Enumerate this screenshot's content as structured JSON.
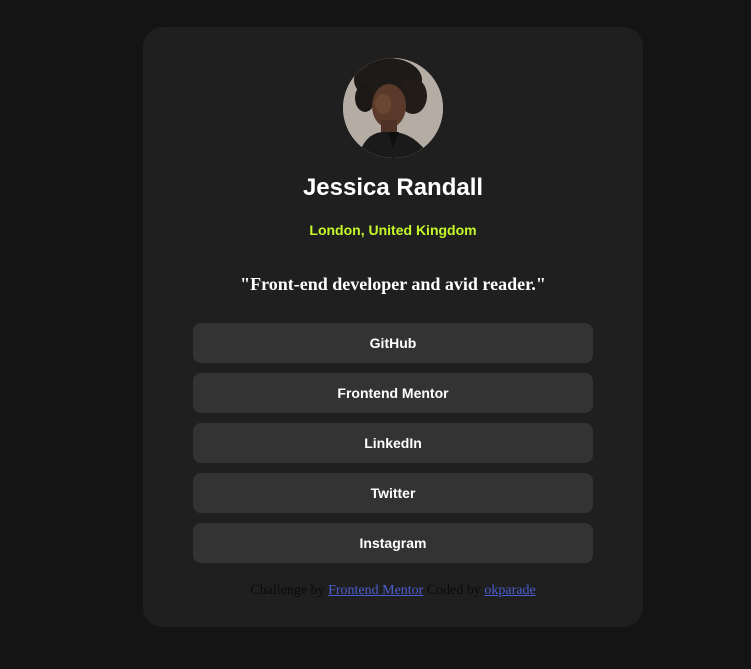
{
  "profile": {
    "name": "Jessica Randall",
    "location": "London, United Kingdom",
    "bio": "\"Front-end developer and avid reader.\"",
    "avatar_icon": "profile-photo"
  },
  "links": [
    {
      "label": "GitHub"
    },
    {
      "label": "Frontend Mentor"
    },
    {
      "label": "LinkedIn"
    },
    {
      "label": "Twitter"
    },
    {
      "label": "Instagram"
    }
  ],
  "attribution": {
    "prefix": "Challenge by",
    "link1": "Frontend Mentor",
    "middle": "Coded by",
    "link2": "okparade"
  },
  "colors": {
    "background": "#141414",
    "card": "#1f1f1f",
    "button": "#333333",
    "accent": "#c4f82a",
    "link": "#4b5fd0"
  }
}
